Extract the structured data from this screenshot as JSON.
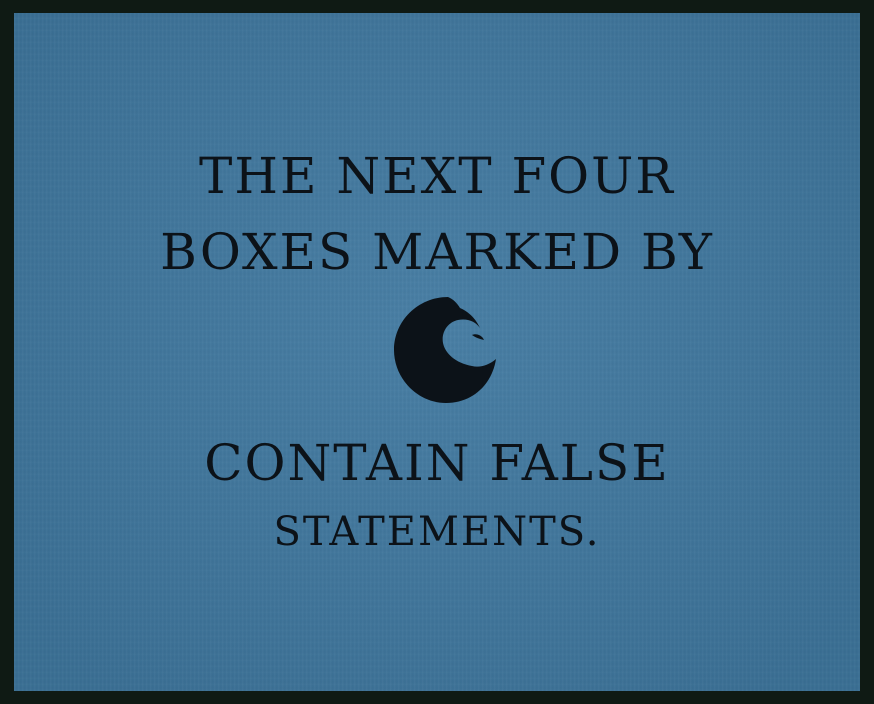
{
  "card": {
    "line1": "THE NEXT FOUR",
    "line2": "BOXES MARKED BY",
    "line3": "CONTAIN FALSE",
    "line4": "STATEMENTS.",
    "marker_icon": "crescent-moon-icon"
  },
  "colors": {
    "background": "#3f78a0",
    "border": "#0f1a14",
    "text": "#0c1218"
  }
}
